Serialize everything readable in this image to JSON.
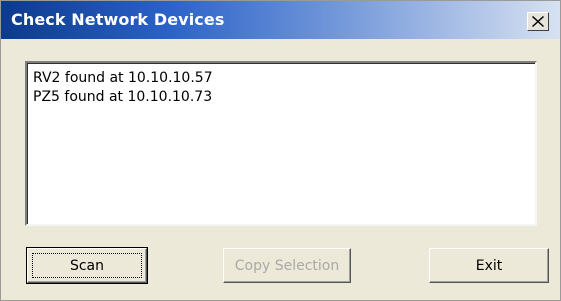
{
  "window": {
    "title": "Check Network Devices",
    "close_icon": "close-icon"
  },
  "results": {
    "items": [
      "RV2 found at 10.10.10.57",
      "PZ5 found at 10.10.10.73"
    ]
  },
  "buttons": {
    "scan_label": "Scan",
    "copy_label": "Copy Selection",
    "exit_label": "Exit"
  },
  "colors": {
    "title_gradient_start": "#0c3a8c",
    "title_gradient_end": "#d7e1f2",
    "dialog_background": "#ece9d8",
    "disabled_text": "#a9a9a9"
  }
}
